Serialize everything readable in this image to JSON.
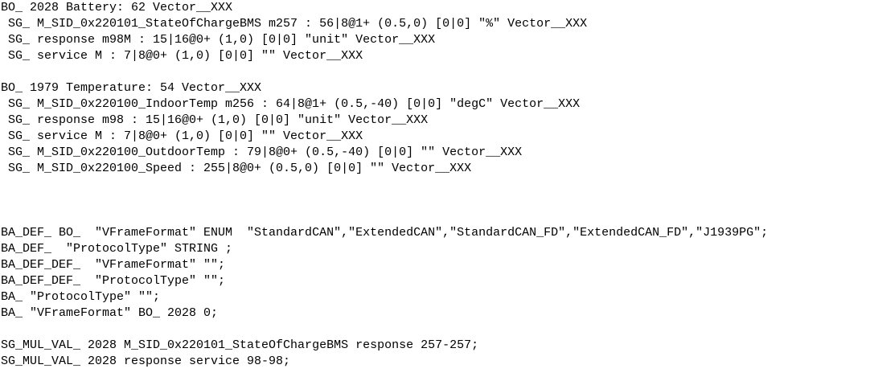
{
  "document": {
    "message_battery": {
      "header": "BO_ 2028 Battery: 62 Vector__XXX",
      "signals": [
        "SG_ M_SID_0x220101_StateOfChargeBMS m257 : 56|8@1+ (0.5,0) [0|0] \"%\" Vector__XXX",
        "SG_ response m98M : 15|16@0+ (1,0) [0|0] \"unit\" Vector__XXX",
        "SG_ service M : 7|8@0+ (1,0) [0|0] \"\" Vector__XXX"
      ]
    },
    "message_temperature": {
      "header": "BO_ 1979 Temperature: 54 Vector__XXX",
      "signals": [
        "SG_ M_SID_0x220100_IndoorTemp m256 : 64|8@1+ (0.5,-40) [0|0] \"degC\" Vector__XXX",
        "SG_ response m98 : 15|16@0+ (1,0) [0|0] \"unit\" Vector__XXX",
        "SG_ service M : 7|8@0+ (1,0) [0|0] \"\" Vector__XXX",
        "SG_ M_SID_0x220100_OutdoorTemp : 79|8@0+ (0.5,-40) [0|0] \"\" Vector__XXX",
        "SG_ M_SID_0x220100_Speed : 255|8@0+ (0.5,0) [0|0] \"\" Vector__XXX"
      ]
    },
    "attribute_lines": [
      "BA_DEF_ BO_  \"VFrameFormat\" ENUM  \"StandardCAN\",\"ExtendedCAN\",\"StandardCAN_FD\",\"ExtendedCAN_FD\",\"J1939PG\";",
      "BA_DEF_  \"ProtocolType\" STRING ;",
      "BA_DEF_DEF_  \"VFrameFormat\" \"\";",
      "BA_DEF_DEF_  \"ProtocolType\" \"\";",
      "BA_ \"ProtocolType\" \"\";",
      "BA_ \"VFrameFormat\" BO_ 2028 0;"
    ],
    "mux_lines": [
      "SG_MUL_VAL_ 2028 M_SID_0x220101_StateOfChargeBMS response 257-257;",
      "SG_MUL_VAL_ 2028 response service 98-98;"
    ]
  }
}
